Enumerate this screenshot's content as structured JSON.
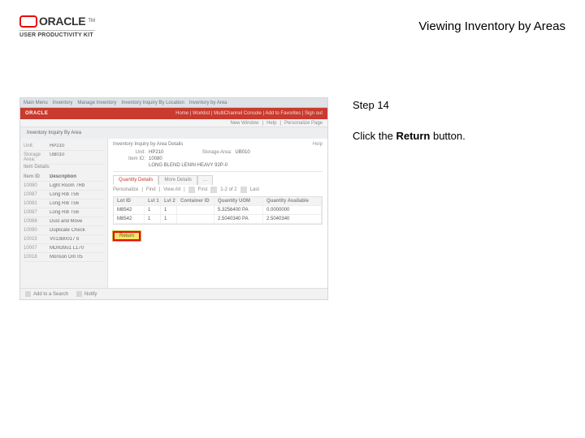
{
  "header": {
    "brand_main": "ORACLE",
    "brand_tm": "TM",
    "brand_sub": "USER PRODUCTIVITY KIT",
    "page_title": "Viewing Inventory by Areas"
  },
  "instruction": {
    "step": "Step 14",
    "pre": "Click the ",
    "bold": "Return",
    "post": " button."
  },
  "mini": {
    "top_items": [
      "Main Menu",
      "Inventory",
      "Manage Inventory",
      "Inventory Inquiry By Location",
      "Inventory by Area"
    ],
    "brand_left": "ORACLE",
    "brand_right": "Home | Worklist | MultiChannel Console | Add to Favorites | Sign out",
    "subbar": [
      "New Window",
      "Help",
      "Personalize Page"
    ],
    "left_title": "Inventory Inquiry By Area",
    "help": "Help",
    "side": {
      "bu_label": "Unit:",
      "bu_value": "HP210",
      "area_label": "Storage Area:",
      "area_value": "UB010",
      "section": "Item Details",
      "cols": [
        "Item ID",
        "Description"
      ],
      "rows": [
        [
          "10080",
          "Light Room 7Rb"
        ],
        [
          "10087",
          "Long Rib T56"
        ],
        [
          "10082",
          "Long Rib T56"
        ],
        [
          "10087",
          "Long Rib T56"
        ],
        [
          "10088",
          "Dust and Move"
        ],
        [
          "10090",
          "Duplicate Check"
        ],
        [
          "10015",
          "V013B0017 b"
        ],
        [
          "10007",
          "MDN3951 L170"
        ],
        [
          "10018",
          "Monson Dm 05"
        ]
      ]
    },
    "main": {
      "title": "Inventory Inquiry by Area Details",
      "fields": [
        [
          "Unit:",
          "HP210"
        ],
        [
          "Item ID:",
          "10080"
        ],
        [
          "Storage Area:",
          "UB010"
        ],
        [
          "",
          "LONG BLEND LENIN HEAVY 92P-0"
        ]
      ],
      "tabs": [
        "Quantity Details",
        "More Details",
        "..."
      ],
      "tools": [
        "Personalize",
        "Find",
        "View All",
        "First",
        "1-2 of 2",
        "Last"
      ],
      "grid_headers": [
        "Lot ID",
        "Lvl 1",
        "Lvl 2",
        "Container ID",
        "Quantity UOM",
        "Quantity Available"
      ],
      "grid_rows": [
        [
          "M8542",
          "1",
          "1",
          "",
          "5.3256400 PA",
          "0.0000000"
        ],
        [
          "M8542",
          "1",
          "1",
          "",
          "2.5040340 PA",
          "2.5040340"
        ]
      ],
      "return_label": "Return"
    },
    "footer": [
      "Add to a Search",
      "Notify"
    ]
  }
}
